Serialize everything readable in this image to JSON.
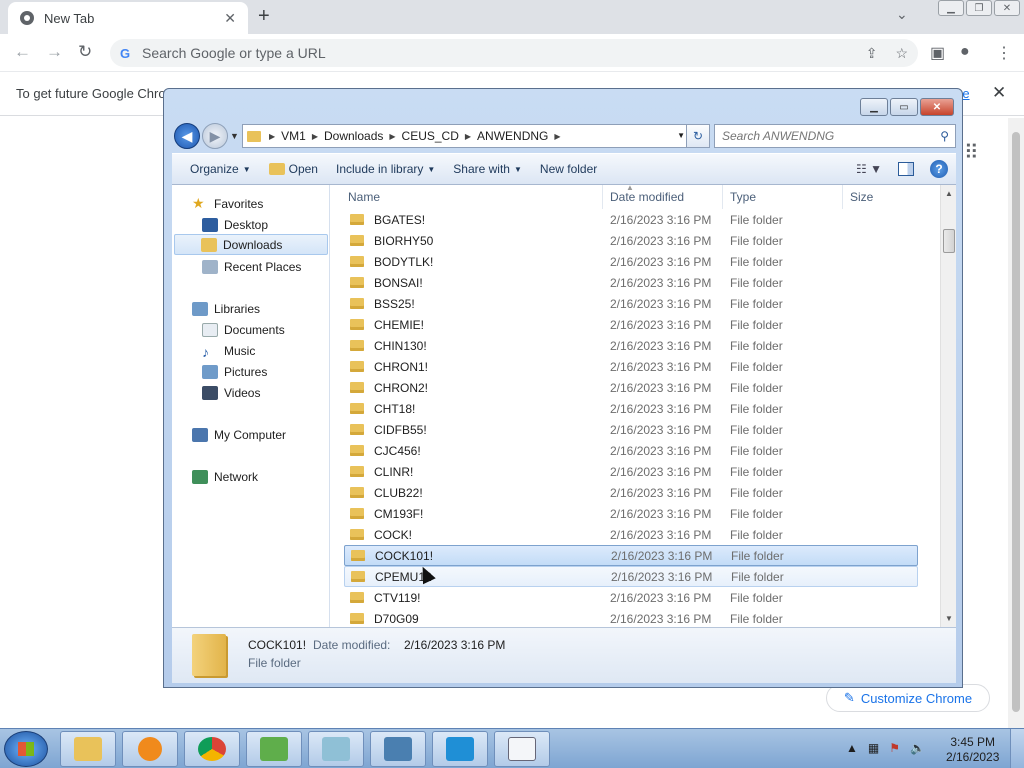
{
  "browser": {
    "tab_title": "New Tab",
    "tab_close": "✕",
    "new_tab": "+",
    "dropdown": "⌄",
    "omnibox_placeholder": "Search Google or type a URL",
    "infobar_message": "To get future Google Chro",
    "infobar_link": "re",
    "infobar_close": "✕",
    "customize_chrome": "Customize Chrome"
  },
  "explorer": {
    "breadcrumbs": [
      "VM1",
      "Downloads",
      "CEUS_CD",
      "ANWENDNG"
    ],
    "search_placeholder": "Search ANWENDNG",
    "commands": {
      "organize": "Organize",
      "open": "Open",
      "include": "Include in library",
      "share": "Share with",
      "new_folder": "New folder"
    },
    "nav": {
      "favorites": "Favorites",
      "desktop": "Desktop",
      "downloads": "Downloads",
      "recent": "Recent Places",
      "libraries": "Libraries",
      "documents": "Documents",
      "music": "Music",
      "pictures": "Pictures",
      "videos": "Videos",
      "computer": "My Computer",
      "network": "Network"
    },
    "columns": {
      "name": "Name",
      "date": "Date modified",
      "type": "Type",
      "size": "Size"
    },
    "rows": [
      {
        "name": "BGATES!",
        "date": "2/16/2023 3:16 PM",
        "type": "File folder"
      },
      {
        "name": "BIORHY50",
        "date": "2/16/2023 3:16 PM",
        "type": "File folder"
      },
      {
        "name": "BODYTLK!",
        "date": "2/16/2023 3:16 PM",
        "type": "File folder"
      },
      {
        "name": "BONSAI!",
        "date": "2/16/2023 3:16 PM",
        "type": "File folder"
      },
      {
        "name": "BSS25!",
        "date": "2/16/2023 3:16 PM",
        "type": "File folder"
      },
      {
        "name": "CHEMIE!",
        "date": "2/16/2023 3:16 PM",
        "type": "File folder"
      },
      {
        "name": "CHIN130!",
        "date": "2/16/2023 3:16 PM",
        "type": "File folder"
      },
      {
        "name": "CHRON1!",
        "date": "2/16/2023 3:16 PM",
        "type": "File folder"
      },
      {
        "name": "CHRON2!",
        "date": "2/16/2023 3:16 PM",
        "type": "File folder"
      },
      {
        "name": "CHT18!",
        "date": "2/16/2023 3:16 PM",
        "type": "File folder"
      },
      {
        "name": "CIDFB55!",
        "date": "2/16/2023 3:16 PM",
        "type": "File folder"
      },
      {
        "name": "CJC456!",
        "date": "2/16/2023 3:16 PM",
        "type": "File folder"
      },
      {
        "name": "CLINR!",
        "date": "2/16/2023 3:16 PM",
        "type": "File folder"
      },
      {
        "name": "CLUB22!",
        "date": "2/16/2023 3:16 PM",
        "type": "File folder"
      },
      {
        "name": "CM193F!",
        "date": "2/16/2023 3:16 PM",
        "type": "File folder"
      },
      {
        "name": "COCK!",
        "date": "2/16/2023 3:16 PM",
        "type": "File folder"
      },
      {
        "name": "COCK101!",
        "date": "2/16/2023 3:16 PM",
        "type": "File folder"
      },
      {
        "name": "CPEMU12",
        "date": "2/16/2023 3:16 PM",
        "type": "File folder"
      },
      {
        "name": "CTV119!",
        "date": "2/16/2023 3:16 PM",
        "type": "File folder"
      },
      {
        "name": "D70G09",
        "date": "2/16/2023 3:16 PM",
        "type": "File folder"
      }
    ],
    "selected_row": 16,
    "hover_row": 17,
    "details": {
      "name": "COCK101!",
      "date_label": "Date modified:",
      "date": "2/16/2023 3:16 PM",
      "type": "File folder"
    }
  },
  "taskbar": {
    "time": "3:45 PM",
    "date": "2/16/2023"
  },
  "colors": {
    "chrome_accent": "#1a73e8",
    "folder": "#e9c25a",
    "selection": "#c3dcf7"
  }
}
